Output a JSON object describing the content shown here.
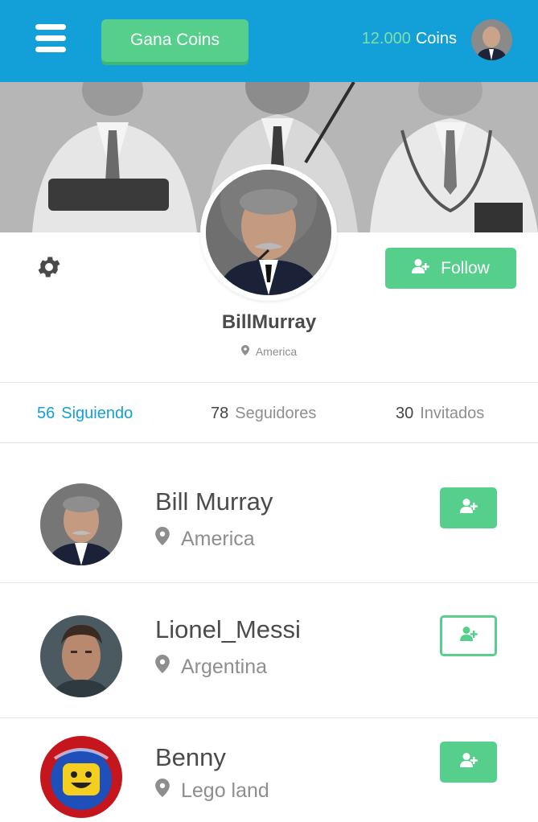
{
  "header": {
    "cta_label": "Gana Coins",
    "coins_value": "12.000",
    "coins_label": "Coins"
  },
  "profile": {
    "username": "BillMurray",
    "location": "America",
    "follow_label": "Follow"
  },
  "stats": [
    {
      "count": "56",
      "label": "Siguiendo",
      "active": true
    },
    {
      "count": "78",
      "label": "Seguidores",
      "active": false
    },
    {
      "count": "30",
      "label": "Invitados",
      "active": false
    }
  ],
  "users": [
    {
      "name": "Bill Murray",
      "location": "America",
      "button_style": "filled"
    },
    {
      "name": "Lionel_Messi",
      "location": "Argentina",
      "button_style": "outline"
    },
    {
      "name": "Benny",
      "location": "Lego land",
      "button_style": "filled"
    }
  ],
  "colors": {
    "header_bg": "#139fd8",
    "accent_green": "#55cf8b",
    "active_blue": "#139fd8"
  },
  "icons": [
    "menu-icon",
    "gear-icon",
    "user-plus-icon",
    "map-pin-icon"
  ]
}
